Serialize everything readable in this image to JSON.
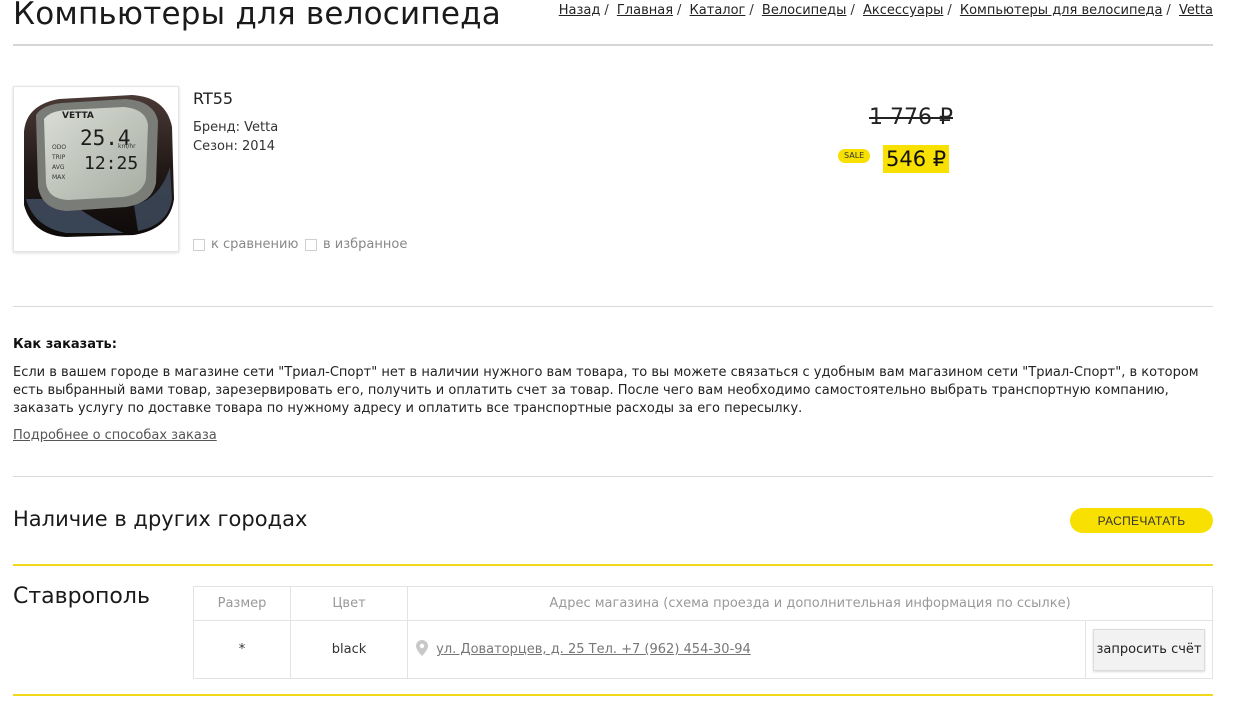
{
  "page": {
    "title": "Компьютеры для велосипеда"
  },
  "breadcrumb": [
    "Назад",
    "Главная",
    "Каталог",
    "Велосипеды",
    "Аксессуары",
    "Компьютеры для велосипеда",
    "Vetta"
  ],
  "product": {
    "name": "RT55",
    "brand_line": "Бренд: Vetta",
    "season_line": "Сезон: 2014",
    "compare_label": "к сравнению",
    "favorite_label": "в избранное",
    "old_price": "1 776 ₽",
    "sale_badge": "SALE",
    "new_price": "546 ₽",
    "image_text": {
      "brand": "VETTA",
      "speed": "25.4",
      "time": "12:25",
      "unit": "km/hr",
      "modes": [
        "ODO",
        "TRIP",
        "AVG",
        "MAX"
      ]
    }
  },
  "how_to_order": {
    "title": "Как заказать:",
    "text": "Если в вашем городе в магазине сети \"Триал-Спорт\" нет в наличии нужного вам товара, то вы можете связаться с удобным вам магазином сети \"Триал-Спорт\", в котором есть выбранный вами товар, зарезервировать его, получить и оплатить счет за товар. После чего вам необходимо самостоятельно выбрать транспортную компанию, заказать услугу по доставке товара по нужному адресу и оплатить все транспортные расходы за его пересылку.",
    "more_link": "Подробнее о способах заказа"
  },
  "availability": {
    "title": "Наличие в других городах",
    "print_button": "РАСПЕЧАТАТЬ",
    "city": "Ставрополь",
    "table": {
      "headers": [
        "Размер",
        "Цвет",
        "Адрес магазина (схема проезда и дополнительная информация по ссылке)"
      ],
      "row": {
        "size": "*",
        "color": "black",
        "address": "ул. Доваторцев, д. 25 Тел. +7 (962) 454-30-94",
        "action": "запросить счёт"
      }
    }
  },
  "colors": {
    "accent": "#f8e000",
    "divider_yellow": "#f4d81a"
  }
}
